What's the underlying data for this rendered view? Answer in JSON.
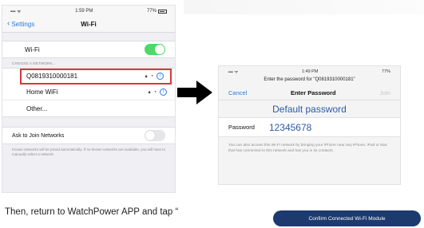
{
  "left_phone": {
    "status": {
      "time": "1:59 PM",
      "battery": "77%"
    },
    "nav": {
      "back_label": "Settings",
      "title": "Wi-Fi"
    },
    "wifi_label": "Wi-Fi",
    "section_label": "CHOOSE A NETWORK...",
    "networks": [
      {
        "name": "Q0819310000181"
      },
      {
        "name": "Home WiFi"
      },
      {
        "name": "Other..."
      }
    ],
    "ask_label": "Ask to Join Networks",
    "footnote": "Known networks will be joined automatically. If no known networks are available, you will have to manually select a network."
  },
  "right_phone": {
    "status": {
      "time": "1:49 PM",
      "battery": "77%"
    },
    "prompt": "Enter the password for \"Q0819310000181\"",
    "nav": {
      "cancel": "Cancel",
      "title": "Enter Password",
      "join": "Join"
    },
    "default_password_label": "Default password",
    "password_label": "Password",
    "password_value": "12345678",
    "note": "You can also access this Wi-Fi network by bringing your iPhone near any iPhone, iPad or Mac that has connected to this network and has you in its contacts."
  },
  "instruction": "Then, return to WatchPower APP and tap “",
  "confirm_button": "Confirm Connected Wi-Fi Module",
  "colors": {
    "accent": "#2a7ae2",
    "highlight": "#d9363e",
    "toggle_on": "#4cd964",
    "button_bg": "#1c3a6e"
  }
}
